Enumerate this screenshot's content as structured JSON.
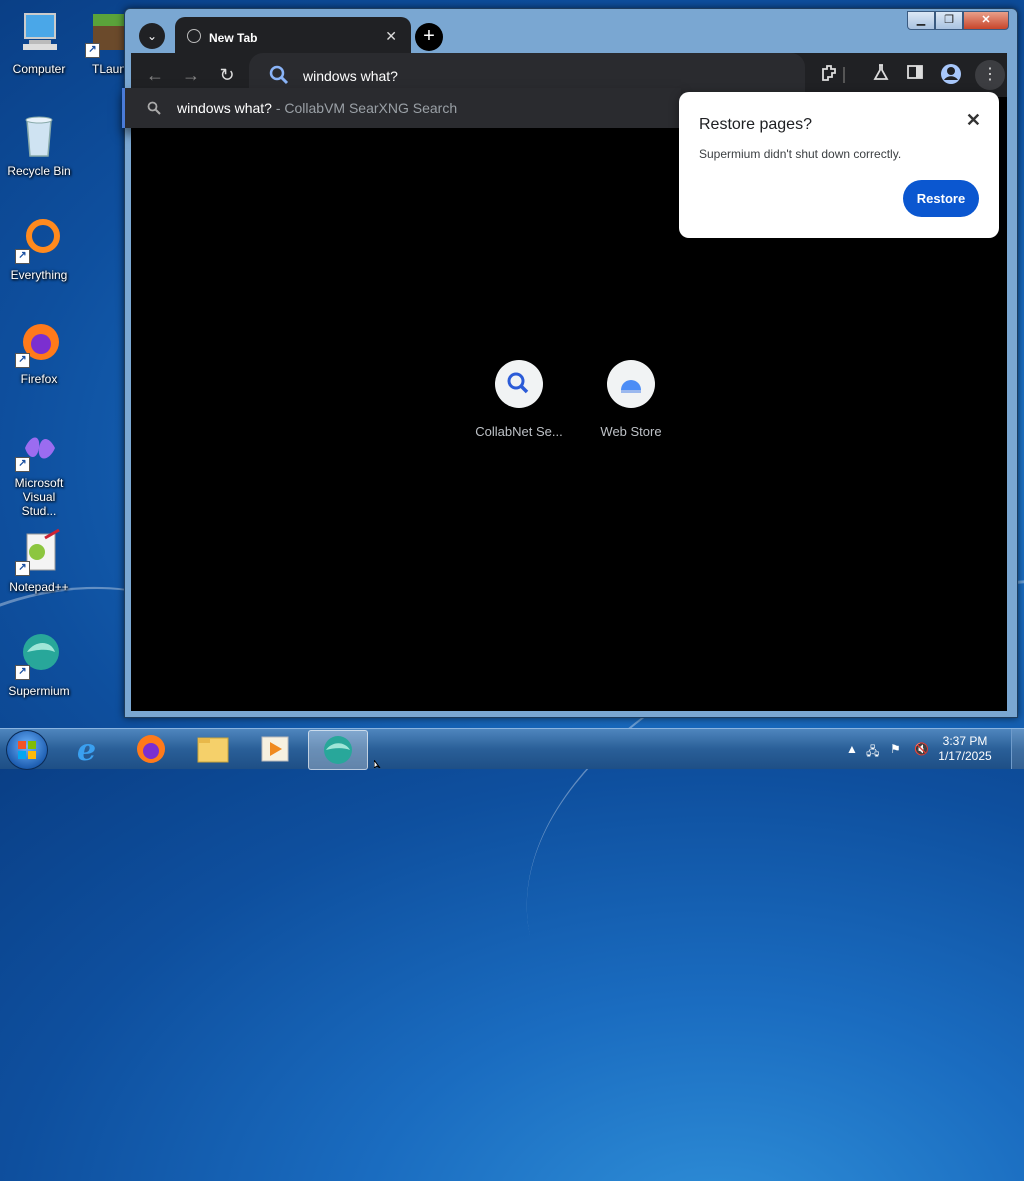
{
  "desktop": {
    "icons": [
      {
        "label": "Computer",
        "icon": "computer-icon"
      },
      {
        "label": "TLaun",
        "icon": "minecraft-icon"
      },
      {
        "label": "Recycle Bin",
        "icon": "recycle-bin-icon"
      },
      {
        "label": "Everything",
        "icon": "everything-icon"
      },
      {
        "label": "Firefox",
        "icon": "firefox-icon"
      },
      {
        "label": "Microsoft Visual Stud...",
        "icon": "visual-studio-icon"
      },
      {
        "label": "Notepad++",
        "icon": "notepadpp-icon"
      },
      {
        "label": "Supermium",
        "icon": "supermium-icon"
      }
    ]
  },
  "browser": {
    "tab": {
      "title": "New Tab"
    },
    "omnibox": {
      "value": "windows what?"
    },
    "suggestion": {
      "query": "windows what?",
      "source": " - CollabVM SearXNG Search"
    },
    "shortcuts": [
      {
        "label": "CollabNet Se...",
        "icon": "search-icon"
      },
      {
        "label": "Web Store",
        "icon": "web-store-icon"
      }
    ],
    "restore_popup": {
      "title": "Restore pages?",
      "message": "Supermium didn't shut down correctly.",
      "button": "Restore"
    }
  },
  "taskbar": {
    "clock_time": "3:37 PM",
    "clock_date": "1/17/2025"
  },
  "colors": {
    "accent": "#0b57d0",
    "toolbar": "#202124",
    "content": "#000000"
  }
}
